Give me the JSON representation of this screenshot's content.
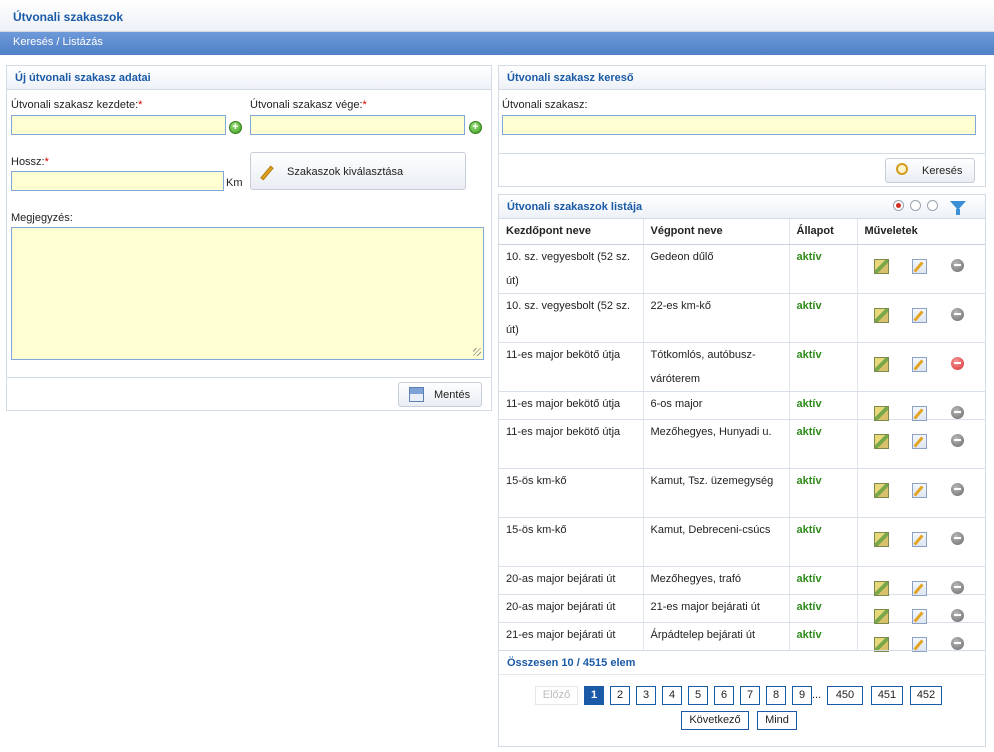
{
  "header": {
    "title": "Útvonali szakaszok"
  },
  "breadcrumb": {
    "text": "Keresés / Listázás"
  },
  "new_form": {
    "title": "Új útvonali szakasz adatai",
    "start_label": "Útvonali szakasz kezdete:",
    "end_label": "Útvonali szakasz vége:",
    "required_mark": "*",
    "length_label": "Hossz:",
    "length_unit": "Km",
    "select_sections_label": "Szakaszok kiválasztása",
    "note_label": "Megjegyzés:",
    "save_label": "Mentés",
    "start_value": "",
    "end_value": "",
    "length_value": "",
    "note_value": ""
  },
  "search": {
    "title": "Útvonali szakasz kereső",
    "field_label": "Útvonali szakasz:",
    "field_value": "",
    "search_label": "Keresés"
  },
  "list": {
    "title": "Útvonali szakaszok listája",
    "columns": [
      "Kezdőpont neve",
      "Végpont neve",
      "Állapot",
      "Műveletek"
    ],
    "rows": [
      {
        "start": "10. sz. vegyesbolt (52 sz. út)",
        "end": "Gedeon dűlő",
        "status": "aktív",
        "delete_active": false
      },
      {
        "start": "10. sz. vegyesbolt (52 sz. út)",
        "end": "22-es km-kő",
        "status": "aktív",
        "delete_active": false
      },
      {
        "start": "11-es major bekötő útja",
        "end": "Tótkomlós, autóbusz-váróterem",
        "status": "aktív",
        "delete_active": true
      },
      {
        "start": "11-es major bekötő útja",
        "end": "6-os major",
        "status": "aktív",
        "delete_active": false
      },
      {
        "start": "11-es major bekötő útja",
        "end": "Mezőhegyes, Hunyadi u.",
        "status": "aktív",
        "delete_active": false
      },
      {
        "start": "15-ös km-kő",
        "end": "Kamut, Tsz. üzemegység",
        "status": "aktív",
        "delete_active": false
      },
      {
        "start": "15-ös km-kő",
        "end": "Kamut, Debreceni-csúcs",
        "status": "aktív",
        "delete_active": false
      },
      {
        "start": "20-as major bejárati út",
        "end": "Mezőhegyes, trafó",
        "status": "aktív",
        "delete_active": false
      },
      {
        "start": "20-as major bejárati út",
        "end": "21-es major bejárati út",
        "status": "aktív",
        "delete_active": false
      },
      {
        "start": "21-es major bejárati út",
        "end": "Árpádtelep bejárati út",
        "status": "aktív",
        "delete_active": false
      }
    ],
    "total_text": "Összesen 10 / 4515 elem"
  },
  "pagination": {
    "prev": "Előző",
    "pages": [
      "1",
      "2",
      "3",
      "4",
      "5",
      "6",
      "7",
      "8",
      "9"
    ],
    "ellipsis": "...",
    "tail_pages": [
      "450",
      "451",
      "452"
    ],
    "current": "1",
    "next": "Következő",
    "all": "Mind"
  },
  "colors": {
    "accent": "#1a5aa6",
    "input_bg": "#ffffd2",
    "status_active": "#2e8b1a",
    "breadcrumb_bar": "#5b88cc"
  }
}
